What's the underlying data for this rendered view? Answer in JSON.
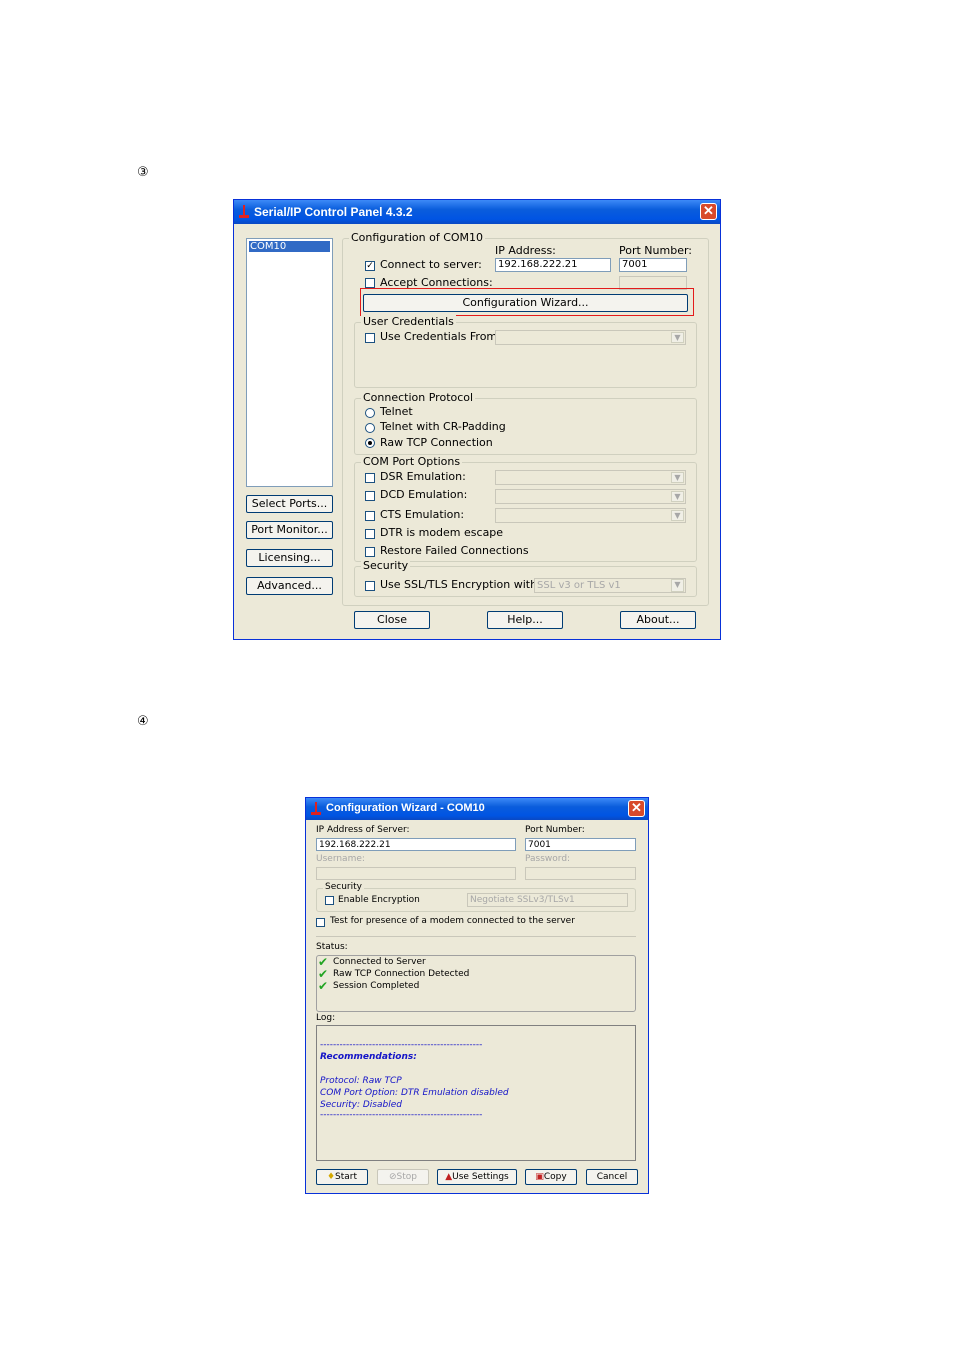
{
  "steps": {
    "step3": "③",
    "step4": "④"
  },
  "control_panel": {
    "title": "Serial/IP Control Panel 4.3.2",
    "ports": [
      "COM10"
    ],
    "config_group": "Configuration of COM10",
    "ip_label": "IP Address:",
    "port_label": "Port Number:",
    "connect_label": "Connect to server:",
    "connect_checked": true,
    "ip_value": "192.168.222.21",
    "port_value": "7001",
    "accept_label": "Accept Connections:",
    "wizard_button": "Configuration Wizard...",
    "credentials_group": "User Credentials",
    "use_credentials_label": "Use Credentials From:",
    "protocol_group": "Connection Protocol",
    "protocol_options": [
      "Telnet",
      "Telnet with CR-Padding",
      "Raw TCP Connection"
    ],
    "protocol_selected": "Raw TCP Connection",
    "com_options_group": "COM Port Options",
    "com_options": [
      "DSR Emulation:",
      "DCD Emulation:",
      "CTS Emulation:",
      "DTR is modem escape",
      "Restore Failed Connections"
    ],
    "security_group": "Security",
    "ssl_label": "Use SSL/TLS Encryption with:",
    "ssl_value": "SSL v3 or TLS v1",
    "side_buttons": [
      "Select Ports...",
      "Port Monitor...",
      "Licensing...",
      "Advanced..."
    ],
    "bottom_buttons": [
      "Close",
      "Help...",
      "About..."
    ],
    "highlight_color": "#e31b1b"
  },
  "wizard": {
    "title": "Configuration Wizard - COM10",
    "ip_label": "IP Address of Server:",
    "ip_value": "192.168.222.21",
    "port_label": "Port Number:",
    "port_value": "7001",
    "username_label": "Username:",
    "password_label": "Password:",
    "security_group": "Security",
    "encryption_label": "Enable Encryption",
    "encryption_value": "Negotiate SSLv3/TLSv1",
    "modem_label": "Test for presence of a modem connected to the server",
    "status_label": "Status:",
    "status_items": [
      "Connected to Server",
      "Raw TCP Connection Detected",
      "Session Completed"
    ],
    "log_label": "Log:",
    "log_separator1": "--------------------------------------------------",
    "log_heading": "Recommendations:",
    "log_lines": [
      "Protocol: Raw TCP",
      "COM Port Option: DTR Emulation disabled",
      "Security: Disabled"
    ],
    "log_separator2": "--------------------------------------------------",
    "buttons": [
      "Start",
      "Stop",
      "Use Settings",
      "Copy",
      "Cancel"
    ]
  }
}
